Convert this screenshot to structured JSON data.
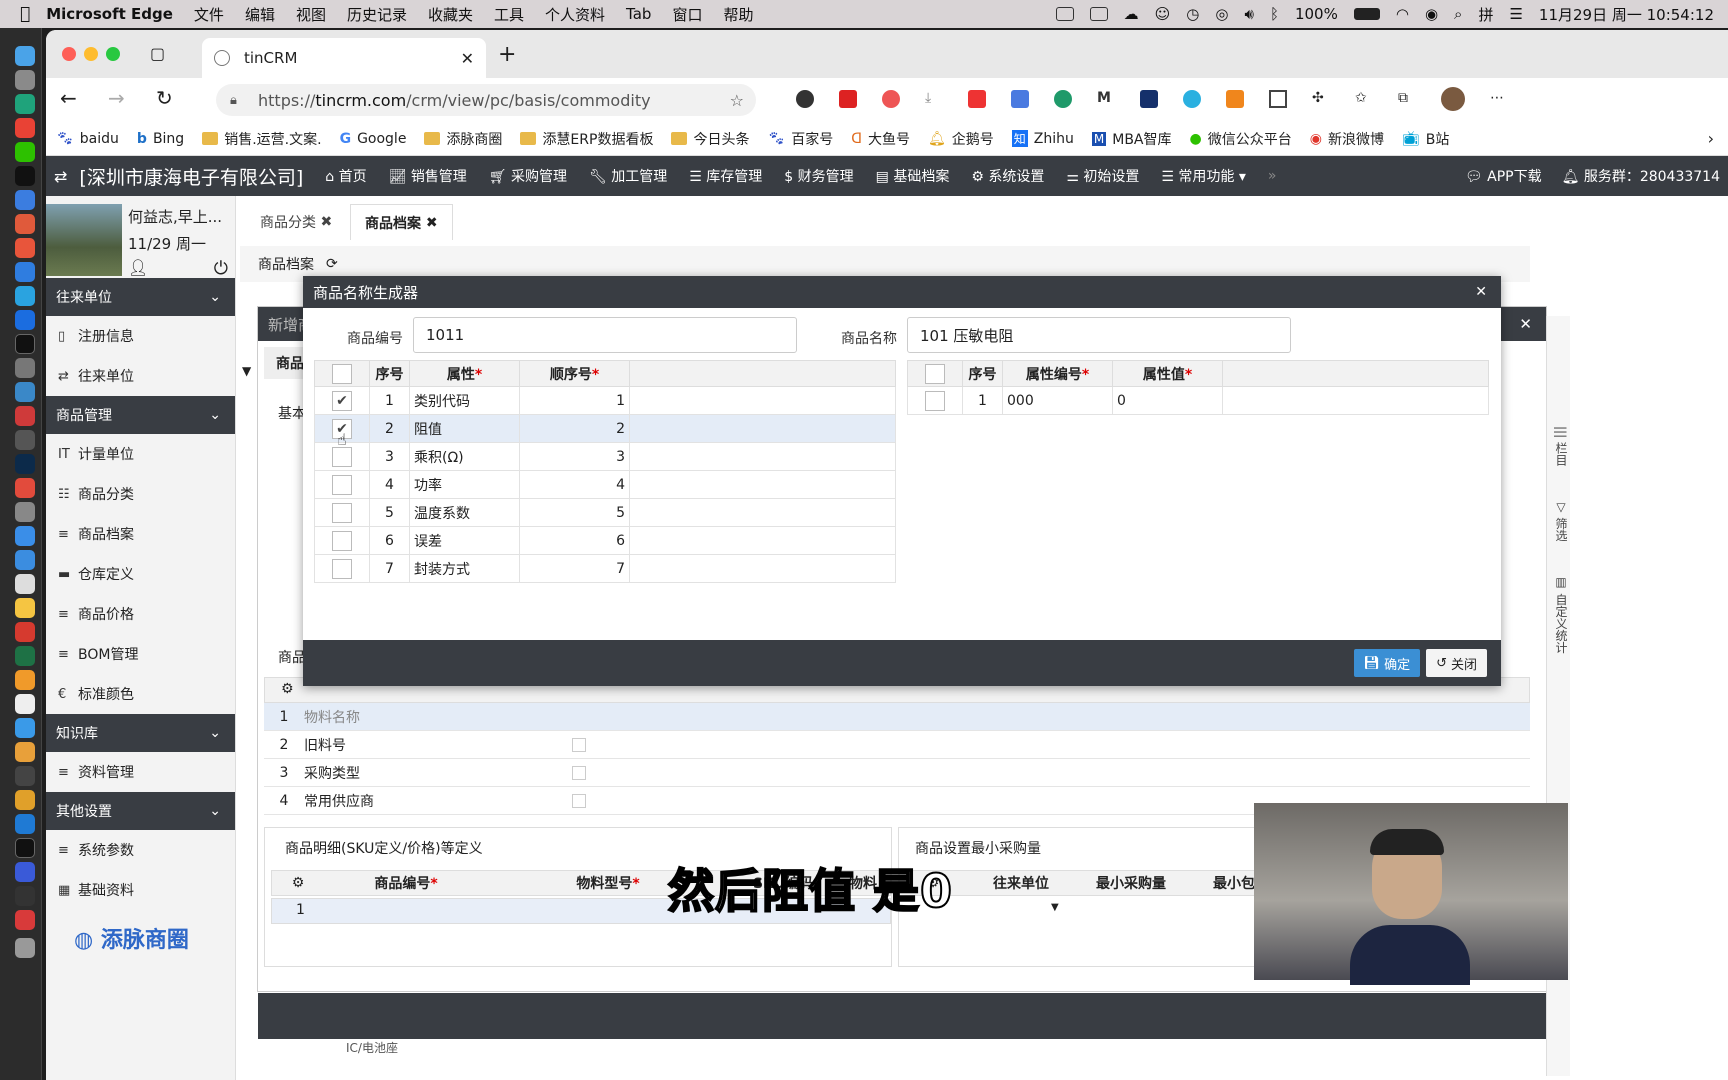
{
  "menubar": {
    "app": "Microsoft Edge",
    "items": [
      "文件",
      "编辑",
      "视图",
      "历史记录",
      "收藏夹",
      "工具",
      "个人资料",
      "Tab",
      "窗口",
      "帮助"
    ],
    "battery": "100%",
    "datetime": "11月29日 周一  10:54:12"
  },
  "browser": {
    "tab_title": "tinCRM",
    "url_prefix": "https://",
    "url_host": "tincrm.com",
    "url_path": "/crm/view/pc/basis/commodity",
    "bookmarks": [
      "baidu",
      "Bing",
      "销售.运营.文案.",
      "Google",
      "添脉商圈",
      "添慧ERP数据看板",
      "今日头条",
      "百家号",
      "大鱼号",
      "企鹅号",
      "Zhihu",
      "MBA智库",
      "微信公众平台",
      "新浪微博",
      "B站"
    ]
  },
  "appnav": {
    "company": "[深圳市康海电子有限公司]",
    "items": [
      "首页",
      "销售管理",
      "采购管理",
      "加工管理",
      "库存管理",
      "财务管理",
      "基础档案",
      "系统设置",
      "初始设置",
      "常用功能"
    ],
    "app_download": "APP下载",
    "service_group": "服务群：280433714"
  },
  "sidebar": {
    "user_greeting": "何益志,早上...",
    "date": "11/29 周一",
    "sections": [
      {
        "title": "往来单位",
        "items": [
          "注册信息",
          "往来单位"
        ]
      },
      {
        "title": "商品管理",
        "items": [
          "计量单位",
          "商品分类",
          "商品档案",
          "仓库定义",
          "商品价格",
          "BOM管理",
          "标准颜色"
        ]
      },
      {
        "title": "知识库",
        "items": [
          "资料管理"
        ]
      },
      {
        "title": "其他设置",
        "items": [
          "系统参数",
          "基础资料"
        ]
      }
    ],
    "logo_text": "添脉商圈"
  },
  "content": {
    "tabs": [
      "商品分类",
      "商品档案"
    ],
    "active_tab": "商品档案",
    "breadcrumb": "商品档案",
    "bg_modal_title": "新增商",
    "bg_section_a": "商品",
    "bg_section_b": "基本",
    "bg_section_c": "商品",
    "bg_rows": [
      {
        "no": "1",
        "name": "物料名称"
      },
      {
        "no": "2",
        "name": "旧料号"
      },
      {
        "no": "3",
        "name": "采购类型"
      },
      {
        "no": "4",
        "name": "常用供应商"
      }
    ],
    "sku_panel_title": "商品明细(SKU定义/价格)等定义",
    "sku_headers": [
      "商品编号",
      "物料型号",
      "SKU编码",
      "物料"
    ],
    "sku_first_row": "1",
    "min_panel_title": "商品设置最小采购量",
    "min_headers": [
      "往来单位",
      "最小采购量",
      "最小包量"
    ],
    "bottom_fragment": "IC/电池座"
  },
  "modal": {
    "title": "商品名称生成器",
    "code_label": "商品编号",
    "code_value": "1011",
    "name_label": "商品名称",
    "name_value": "101 压敏电阻",
    "left_headers": [
      "序号",
      "属性",
      "顺序号"
    ],
    "left_rows": [
      {
        "no": "1",
        "attr": "类别代码",
        "order": "1",
        "checked": true
      },
      {
        "no": "2",
        "attr": "阻值",
        "order": "2",
        "checked": true
      },
      {
        "no": "3",
        "attr": "乘积(Ω)",
        "order": "3",
        "checked": false
      },
      {
        "no": "4",
        "attr": "功率",
        "order": "4",
        "checked": false
      },
      {
        "no": "5",
        "attr": "温度系数",
        "order": "5",
        "checked": false
      },
      {
        "no": "6",
        "attr": "误差",
        "order": "6",
        "checked": false
      },
      {
        "no": "7",
        "attr": "封装方式",
        "order": "7",
        "checked": false
      }
    ],
    "right_headers": [
      "序号",
      "属性编号",
      "属性值"
    ],
    "right_rows": [
      {
        "no": "1",
        "code": "000",
        "value": "0"
      }
    ],
    "confirm_label": "确定",
    "close_label": "关闭"
  },
  "right_rail": {
    "labels": [
      "栏目",
      "筛选",
      "自定义统计"
    ]
  },
  "subtitle": "然后阻值 是0"
}
